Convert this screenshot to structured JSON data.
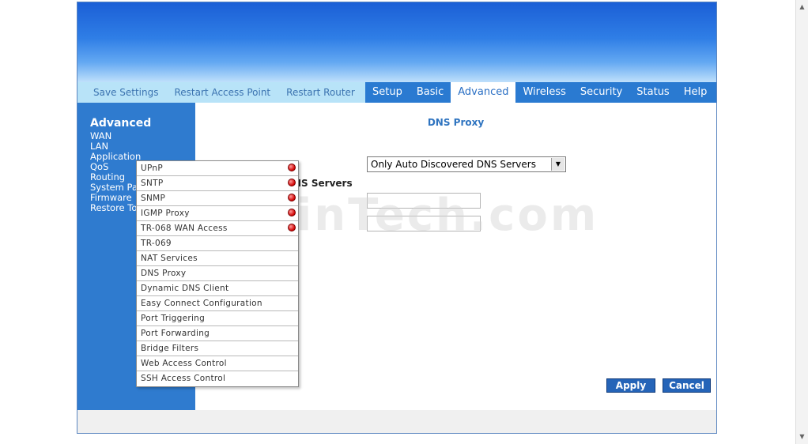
{
  "topnav": {
    "links": [
      "Save Settings",
      "Restart Access Point",
      "Restart Router"
    ],
    "tabs": [
      "Setup",
      "Basic",
      "Advanced",
      "Wireless",
      "Security",
      "Status",
      "Help"
    ],
    "active_tab": "Advanced"
  },
  "sidebar": {
    "heading": "Advanced",
    "items": [
      "WAN",
      "LAN",
      "Application",
      "QoS",
      "Routing",
      "System Pa",
      "Firmware",
      "Restore To"
    ]
  },
  "content": {
    "title": "DNS Proxy",
    "dns_label": "NS Servers",
    "select_value": "Only Auto Discovered DNS Servers",
    "apply_label": "Apply",
    "cancel_label": "Cancel"
  },
  "menu": {
    "items": [
      "UPnP",
      "SNTP",
      "SNMP",
      "IGMP Proxy",
      "TR-068 WAN Access",
      "TR-069",
      "NAT Services",
      "DNS Proxy",
      "Dynamic DNS Client",
      "Easy Connect Configuration",
      "Port Triggering",
      "Port Forwarding",
      "Bridge Filters",
      "Web Access Control",
      "SSH Access Control"
    ],
    "indicator_color": "#d00000"
  },
  "watermark": "PcWinTech.com",
  "colors": {
    "banner": "#2f7ee6",
    "tab_bar": "#2a7ad1",
    "link_bar": "#b8e3f8",
    "sidebar": "#2f7bcf",
    "button": "#2564b8"
  }
}
